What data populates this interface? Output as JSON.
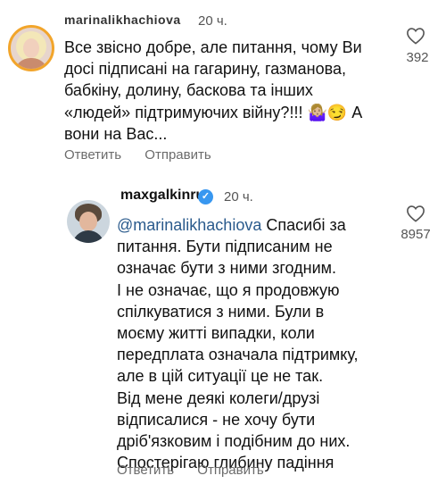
{
  "comments": [
    {
      "username": "marinalikhachiova",
      "time": "20 ч.",
      "text": "Все звісно добре, але питання, чому Ви\nдосі підписані на гагарину, газманова,\nбабкіну, долину, баскова та інших\n«людей» підтримуючих війну?!!! 🤷🏼‍♀️😏 А\nвони на Вас...",
      "actions": [
        "Ответить",
        "Отправить"
      ],
      "likes": "392",
      "icon": "heart-outline-icon"
    },
    {
      "username": "maxgalkinru",
      "verified": true,
      "time": "20 ч.",
      "mention": "@marinalikhachiova",
      "text": " Спасибі за\nпитання.  Бути підписаним не\nозначає бути з ними згодним.\nІ не означає, що я продовжую\nспілкуватися з ними.  Були в\nмоєму житті випадки, коли\nпередплата означала підтримку,\nале в цій ситуації це не так.\nВід мене деякі колеги/друзі\nвідписалися - не хочу бути\nдріб'язковим і подібним до них.\nСпостерігаю глибину падіння",
      "actions": [
        "Ответить",
        "Отправить"
      ],
      "likes": "8957",
      "icon": "heart-outline-icon"
    }
  ],
  "colors": {
    "mention": "#2a5a8c",
    "verified": "#3897f0",
    "story_ring": "#f2a52b"
  }
}
